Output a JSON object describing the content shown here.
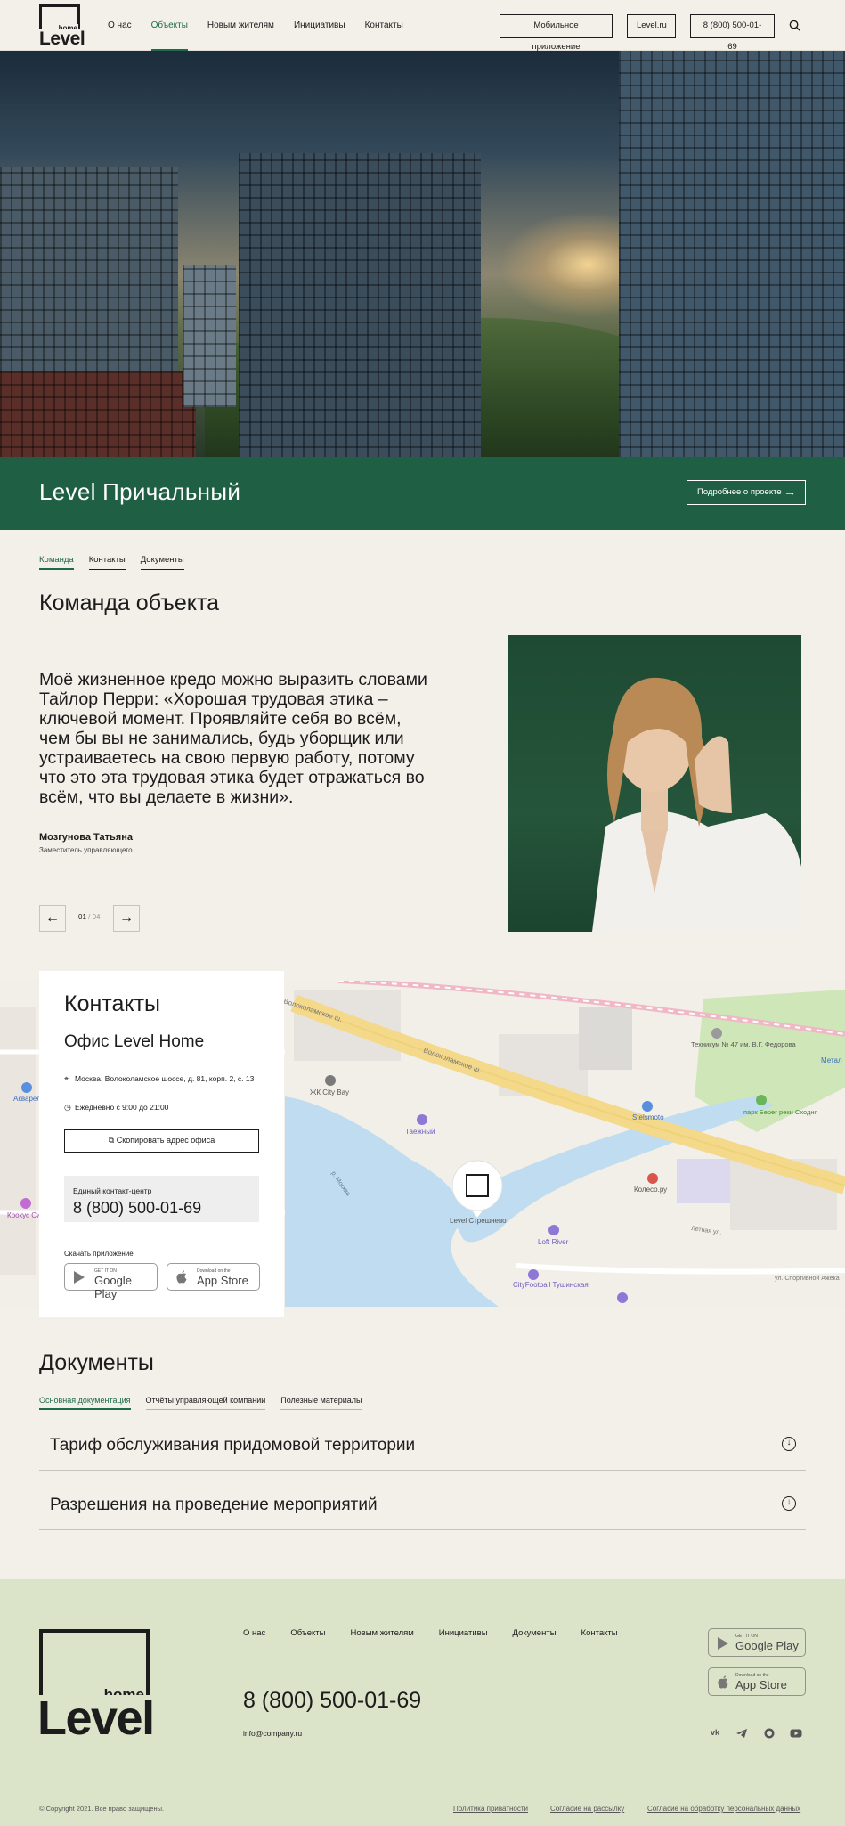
{
  "header": {
    "logo_small": "home",
    "logo_big": "Level",
    "nav": [
      "О нас",
      "Объекты",
      "Новым жителям",
      "Инициативы",
      "Контакты"
    ],
    "active_nav": 1,
    "btn_app": "Мобильное приложение",
    "btn_site": "Level.ru",
    "btn_phone": "8 (800) 500-01-69"
  },
  "band": {
    "title": "Level Причальный",
    "more": "Подробнее о проекте"
  },
  "team": {
    "tabs": [
      "Команда",
      "Контакты",
      "Документы"
    ],
    "heading": "Команда объекта",
    "quote": "Моё жизненное кредо можно выразить словами Тайлор Перри: «Хорошая трудовая этика – ключевой момент. Проявляйте себя во всём, чем бы вы не занимались, будь уборщик или устраиваетесь на свою первую работу, потому что это эта трудовая этика будет отражаться во всём, что вы делаете в жизни».",
    "name": "Мозгунова Татьяна",
    "role": "Заместитель управляющего",
    "counter_current": "01",
    "counter_total": "/ 04"
  },
  "contacts": {
    "heading": "Контакты",
    "office": "Офис Level Home",
    "address": "Москва, Волоколамское шоссе, д. 81, корп. 2, с. 13",
    "hours": "Ежедневно с 9:00 до 21:00",
    "copy_btn": "Скопировать адрес офиса",
    "center_label": "Единый контакт-центр",
    "center_phone": "8 (800) 500-01-69",
    "download": "Скачать приложение",
    "gp_small": "GET IT ON",
    "gp_big": "Google Play",
    "as_small": "Download on the",
    "as_big": "App Store"
  },
  "map": {
    "labels": {
      "road1": "Волоколамское ш.",
      "road2": "Волоколамское ш.",
      "cityBay": "ЖК City Bay",
      "taejnyy": "Таёжный",
      "stelsmoto": "Stelsmoto",
      "tech": "Техникум № 47 им. В.Г. Федорова",
      "park": "парк Берег реки Сходня",
      "metal": "Метал",
      "akvarel": "Акварели",
      "krokus": "Крокус Сити Хол",
      "koleso": "Колесо.ру",
      "river": "р. Москва",
      "marker": "Level Стрешнево",
      "loft": "Loft River",
      "city_football": "CityFootball Тушинская",
      "lesnaya": "Летная ул.",
      "sport": "ул. Спортивной Ажека"
    }
  },
  "documents": {
    "heading": "Документы",
    "tabs": [
      "Основная документация",
      "Отчёты управляющей компании",
      "Полезные материалы"
    ],
    "rows": [
      "Тариф обслуживания придомовой территории",
      "Разрешения на проведение мероприятий"
    ]
  },
  "footer": {
    "logo_small": "home",
    "logo_big": "Level",
    "nav": [
      "О нас",
      "Объекты",
      "Новым жителям",
      "Инициативы",
      "Документы",
      "Контакты"
    ],
    "phone": "8 (800) 500-01-69",
    "email": "info@company.ru",
    "gp_small": "GET IT ON",
    "gp_big": "Google Play",
    "as_small": "Download on the",
    "as_big": "App Store",
    "socials": [
      "vk-icon",
      "telegram-icon",
      "whatsapp-icon",
      "youtube-icon"
    ],
    "copyright": "© Copyright 2021. Все право защищены.",
    "links": [
      "Политика приватности",
      "Согласие на рассылку",
      "Согласие на обработку персональных данных"
    ]
  },
  "colors": {
    "background": "#f3efe9",
    "accent_green": "#1f5f43",
    "footer_bg": "#dbe3c9"
  }
}
